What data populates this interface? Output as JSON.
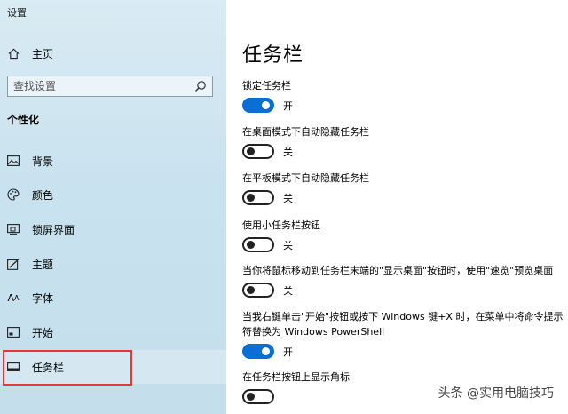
{
  "window": {
    "title": "设置"
  },
  "sidebar": {
    "home_label": "主页",
    "search_placeholder": "查找设置",
    "section_title": "个性化",
    "items": [
      {
        "label": "背景",
        "icon": "image-icon"
      },
      {
        "label": "颜色",
        "icon": "palette-icon"
      },
      {
        "label": "锁屏界面",
        "icon": "lockscreen-icon"
      },
      {
        "label": "主题",
        "icon": "theme-icon"
      },
      {
        "label": "字体",
        "icon": "font-icon"
      },
      {
        "label": "开始",
        "icon": "start-icon"
      },
      {
        "label": "任务栏",
        "icon": "taskbar-icon"
      }
    ]
  },
  "main": {
    "title": "任务栏",
    "settings": [
      {
        "label": "锁定任务栏",
        "on": true,
        "state": "开"
      },
      {
        "label": "在桌面模式下自动隐藏任务栏",
        "on": false,
        "state": "关"
      },
      {
        "label": "在平板模式下自动隐藏任务栏",
        "on": false,
        "state": "关"
      },
      {
        "label": "使用小任务栏按钮",
        "on": false,
        "state": "关"
      },
      {
        "label": "当你将鼠标移动到任务栏末端的\"显示桌面\"按钮时，使用\"速览\"预览桌面",
        "on": false,
        "state": "关"
      },
      {
        "label": "当我右键单击\"开始\"按钮或按下 Windows 键+X 时，在菜单中将命令提示符替换为 Windows PowerShell",
        "on": true,
        "state": "开"
      },
      {
        "label": "在任务栏按钮上显示角标",
        "on": false,
        "state": ""
      }
    ]
  },
  "watermark": "头条 @实用电脑技巧",
  "colors": {
    "accent": "#0a6fd4",
    "highlight": "#e03a3a"
  }
}
